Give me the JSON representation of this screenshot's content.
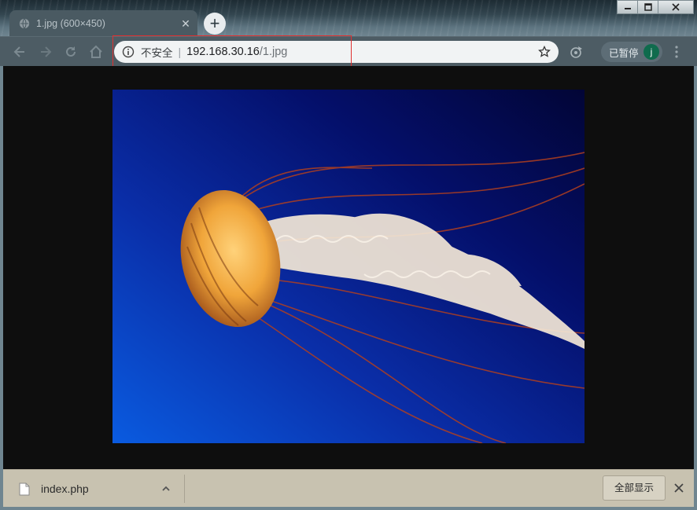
{
  "tab": {
    "title": "1.jpg (600×450)",
    "favicon": "globe-icon",
    "close_icon": "close-icon",
    "close_glyph": "✕"
  },
  "new_tab_glyph": "+",
  "window_controls": [
    "minimize-icon",
    "maximize-icon",
    "close-icon"
  ],
  "nav": [
    "back-arrow-icon",
    "forward-arrow-icon",
    "reload-icon",
    "home-icon"
  ],
  "omnibox": {
    "insecure_label": "不安全",
    "separator": "|",
    "host": "192.168.30.16",
    "path": "/1.jpg",
    "info_icon": "info-icon",
    "star_icon": "star-icon"
  },
  "profile": {
    "status": "已暂停",
    "avatar_letter": "j"
  },
  "image": {
    "subject": "jellyfish-photo",
    "width": 600,
    "height": 450
  },
  "downloads": {
    "file_name": "index.php",
    "show_all": "全部显示"
  },
  "colors": {
    "accent_highlight": "#e03030",
    "viewport_bg": "#0e0e0e",
    "shelf_bg": "#c8c2b0",
    "avatar_bg": "#0f6b4d"
  }
}
